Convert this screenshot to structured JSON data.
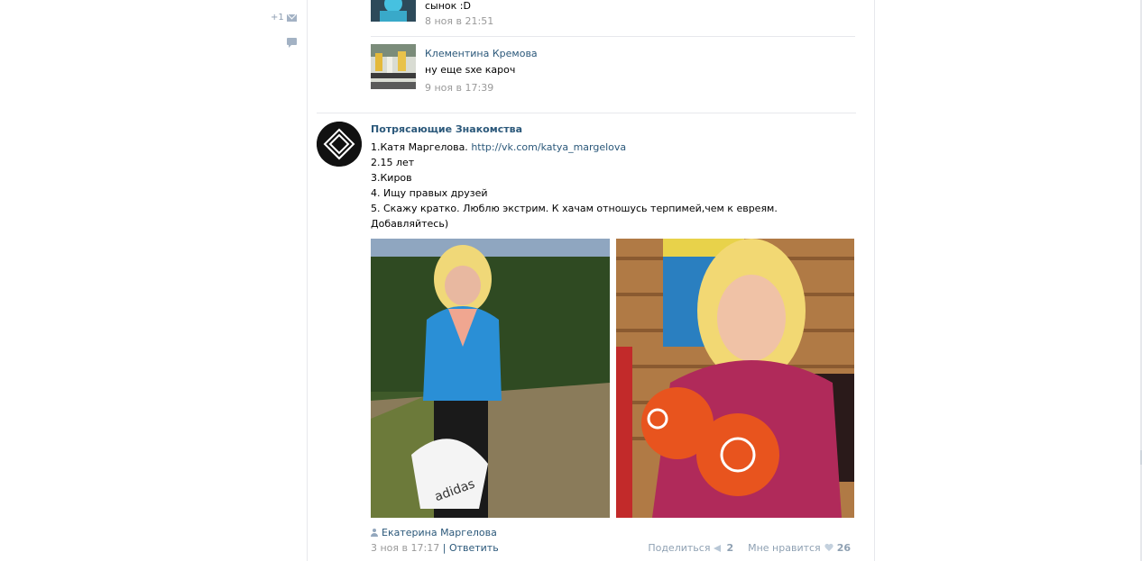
{
  "left": {
    "counter_label": "+1",
    "mail_icon": "mail-icon",
    "comment_icon": "comment-icon"
  },
  "replies": [
    {
      "author": "",
      "text": "сынок :D",
      "time": "8 ноя в 21:51"
    },
    {
      "author": "Клементина Кремова",
      "text": "ну еще sxe кароч",
      "time": "9 ноя в 17:39"
    }
  ],
  "post": {
    "author": "Потрясающие Знакомства",
    "lines": {
      "line1_prefix": "1.Катя Маргелова. ",
      "line1_link": "http://vk.com/katya_margelova",
      "line2": "2.15 лет",
      "line3": "3.Киров",
      "line4": "4. Ищу правых друзей",
      "line5": "5. Скажу кратко. Люблю экстрим. К хачам отношусь терпимей,чем к евреям.",
      "line6": "Добавляйтесь)"
    },
    "signer": "Екатерина Маргелова",
    "date": "3 ноя в 17:17",
    "separator": "|",
    "reply_link": "Ответить",
    "share_label": "Поделиться",
    "share_count": "2",
    "like_label": "Мне нравится",
    "like_count": "26"
  },
  "colors": {
    "link": "#2b587a",
    "muted": "#999999",
    "divider": "#e7e8ec"
  }
}
